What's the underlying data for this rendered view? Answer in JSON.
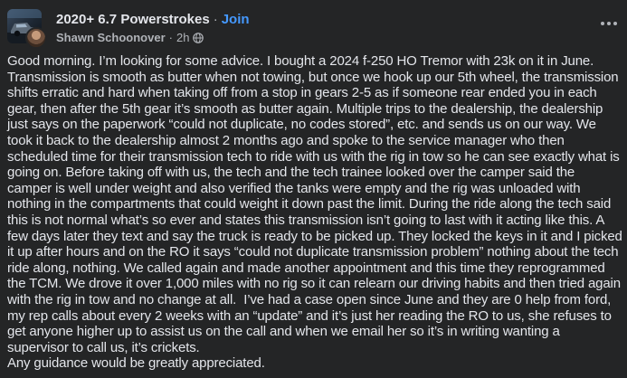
{
  "post": {
    "group_name": "2020+ 6.7 Powerstrokes",
    "join_label": "Join",
    "author": "Shawn Schoonover",
    "time": "2h",
    "body": "Good morning. I’m looking for some advice. I bought a 2024 f-250 HO Tremor with 23k on it in June. Transmission is smooth as butter when not towing, but once we hook up our 5th wheel, the transmission shifts erratic and hard when taking off from a stop in gears 2-5 as if someone rear ended you in each gear, then after the 5th gear it’s smooth as butter again. Multiple trips to the dealership, the dealership just says on the paperwork “could not duplicate, no codes stored”, etc. and sends us on our way. We took it back to the dealership almost 2 months ago and spoke to the service manager who then scheduled time for their transmission tech to ride with us with the rig in tow so he can see exactly what is going on. Before taking off with us, the tech and the tech trainee looked over the camper said the camper is well under weight and also verified the tanks were empty and the rig was unloaded with nothing in the compartments that could weight it down past the limit. During the ride along the tech said this is not normal what’s so ever and states this transmission isn’t going to last with it acting like this. A few days later they text and say the truck is ready to be picked up. They locked the keys in it and I picked it up after hours and on the RO it says “could not duplicate transmission problem” nothing about the tech ride along, nothing. We called again and made another appointment and this time they reprogrammed the TCM. We drove it over 1,000 miles with no rig so it can relearn our driving habits and then tried again with the rig in tow and no change at all.  I’ve had a case open since June and they are 0 help from ford, my rep calls about every 2 weeks with an “update” and it’s just her reading the RO to us, she refuses to get anyone higher up to assist us on the call and when we email her so it’s in writing wanting a supervisor to call us, it’s crickets.\nAny guidance would be greatly appreciated."
  },
  "icons": {
    "privacy": "globe-icon",
    "menu": "more-options-icon"
  },
  "colors": {
    "background": "#242526",
    "primary_text": "#e4e6eb",
    "secondary_text": "#b0b3b8",
    "link": "#4599ff"
  }
}
